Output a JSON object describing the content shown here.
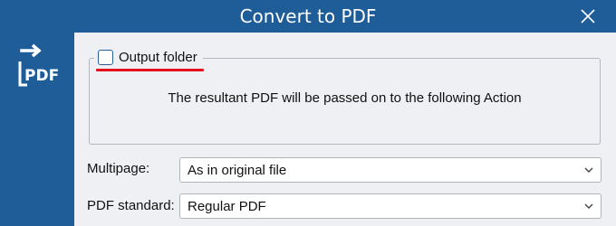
{
  "window": {
    "title": "Convert to PDF"
  },
  "sidebar": {
    "icon": "pdf-convert-icon",
    "icon_text": "PDF"
  },
  "output_group": {
    "checkbox_label": "Output folder",
    "checked": false,
    "message": "The resultant PDF will be passed on to the following Action",
    "highlight_color": "#e3121c"
  },
  "fields": {
    "multipage": {
      "label": "Multipage:",
      "value": "As in original file"
    },
    "pdf_standard": {
      "label": "PDF standard:",
      "value": "Regular PDF"
    }
  },
  "colors": {
    "accent": "#1f5d99",
    "background": "#eef0f3"
  }
}
